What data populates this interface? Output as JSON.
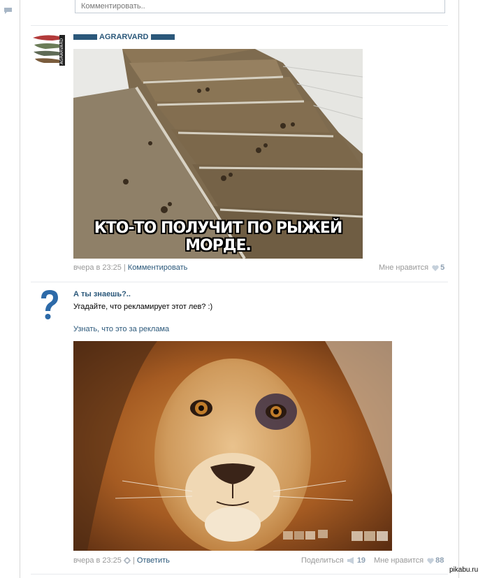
{
  "comment_input": {
    "placeholder": "Комментировать.."
  },
  "post1": {
    "author": "AGRARVARD",
    "meme_caption": "КТО-ТО ПОЛУЧИТ ПО РЫЖЕЙ МОРДЕ.",
    "time": "вчера в 23:25",
    "action": "Комментировать",
    "like_label": "Мне нравится",
    "like_count": "5"
  },
  "post2": {
    "author": "А ты знаешь?..",
    "text": "Угадайте, что рекламирует этот лев? :)",
    "link": "Узнать, что это за реклама",
    "time": "вчера в 23:25",
    "action": "Ответить",
    "share_label": "Поделиться",
    "share_count": "19",
    "like_label": "Мне нравится",
    "like_count": "88"
  },
  "watermark": "pikabu.ru",
  "colors": {
    "link": "#2b587a",
    "meta": "#999999",
    "count": "#8fa1b3",
    "border": "#d7d7d7"
  },
  "icons": [
    "chat-bubble-icon",
    "heart-icon",
    "megaphone-icon",
    "gear-icon",
    "question-icon"
  ]
}
